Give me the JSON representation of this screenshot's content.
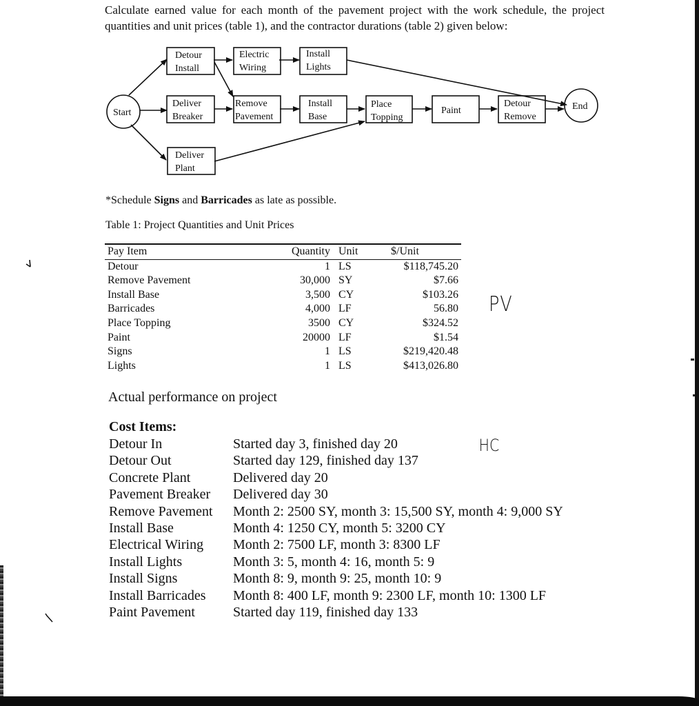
{
  "intro": "Calculate earned value for each month of the pavement project with the work schedule, the project quantities and unit prices (table 1), and the contractor durations (table 2) given below:",
  "diagram": {
    "start": "Start",
    "end": "End",
    "nodes": {
      "detour_install": [
        "Detour",
        "Install"
      ],
      "electric_wiring": [
        "Electric",
        "Wiring"
      ],
      "install_lights": [
        "Install",
        "Lights"
      ],
      "deliver_breaker": [
        "Deliver",
        "Breaker"
      ],
      "remove_pavement": [
        "Remove",
        "Pavement"
      ],
      "install_base": [
        "Install",
        "Base"
      ],
      "place_topping": [
        "Place",
        "Topping"
      ],
      "paint": [
        "Paint"
      ],
      "detour_remove": [
        "Detour",
        "Remove"
      ],
      "deliver_plant": [
        "Deliver",
        "Plant"
      ]
    }
  },
  "note": {
    "prefix": "*Schedule ",
    "bold1": "Signs",
    "mid": " and ",
    "bold2": "Barricades",
    "suffix": " as late as possible."
  },
  "table1": {
    "caption": "Table 1: Project Quantities and Unit Prices",
    "headers": [
      "Pay Item",
      "Quantity",
      "Unit",
      "$/Unit"
    ],
    "rows": [
      {
        "item": "Detour",
        "quantity": "1",
        "unit": "LS",
        "price": "$118,745.20"
      },
      {
        "item": "Remove Pavement",
        "quantity": "30,000",
        "unit": "SY",
        "price": "$7.66"
      },
      {
        "item": "Install Base",
        "quantity": "3,500",
        "unit": "CY",
        "price": "$103.26"
      },
      {
        "item": "Barricades",
        "quantity": "4,000",
        "unit": "LF",
        "price": "56.80"
      },
      {
        "item": "Place Topping",
        "quantity": "3500",
        "unit": "CY",
        "price": "$324.52"
      },
      {
        "item": "Paint",
        "quantity": "20000",
        "unit": "LF",
        "price": "$1.54"
      },
      {
        "item": "Signs",
        "quantity": "1",
        "unit": "LS",
        "price": "$219,420.48"
      },
      {
        "item": "Lights",
        "quantity": "1",
        "unit": "LS",
        "price": "$413,026.80"
      }
    ]
  },
  "handwriting": {
    "pv": "PV",
    "ac": "HC"
  },
  "actual": {
    "title": "Actual performance on project",
    "heading": "Cost Items:",
    "items": [
      {
        "name": "Detour In",
        "detail": "Started day 3, finished day 20"
      },
      {
        "name": "Detour Out",
        "detail": "Started day 129, finished day 137"
      },
      {
        "name": "Concrete Plant",
        "detail": "Delivered day 20"
      },
      {
        "name": "Pavement Breaker",
        "detail": "Delivered day 30"
      },
      {
        "name": "Remove Pavement",
        "detail": "Month 2: 2500 SY, month 3: 15,500 SY, month 4: 9,000 SY"
      },
      {
        "name": "Install Base",
        "detail": "Month 4: 1250 CY, month 5: 3200 CY"
      },
      {
        "name": "Electrical Wiring",
        "detail": "Month 2: 7500 LF, month 3: 8300 LF"
      },
      {
        "name": "Install Lights",
        "detail": "Month 3: 5, month 4: 16, month 5: 9"
      },
      {
        "name": "Install Signs",
        "detail": "Month 8: 9, month 9: 25, month 10: 9"
      },
      {
        "name": "Install Barricades",
        "detail": "Month 8: 400 LF, month 9: 2300 LF, month 10: 1300 LF"
      },
      {
        "name": "Paint Pavement",
        "detail": "Started day 119, finished day 133"
      }
    ]
  }
}
